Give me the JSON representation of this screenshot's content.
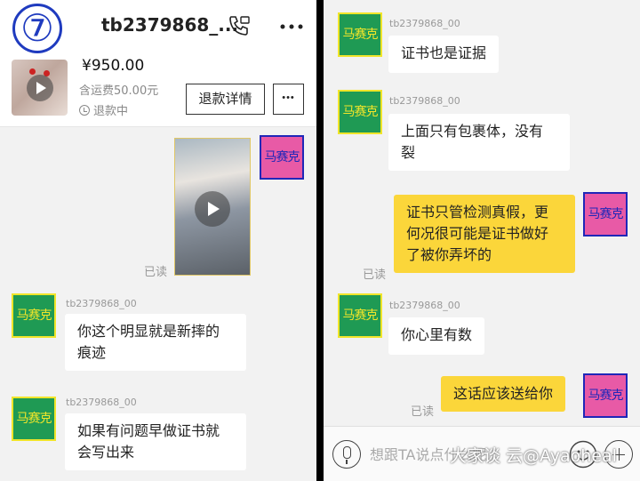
{
  "annotation": {
    "number": "⑦"
  },
  "left": {
    "header": {
      "title": "tb2379868_...",
      "order": {
        "price": "¥950.00",
        "shipping": "含运费50.00元",
        "status": "退款中"
      },
      "refund_button": "退款详情"
    },
    "messages": [
      {
        "type": "video",
        "sender": "seller",
        "avatar_text": "马赛克",
        "read": "已读"
      },
      {
        "type": "text",
        "sender": "buyer",
        "avatar_text": "马赛克",
        "username": "tb2379868_00",
        "lines": [
          "你这个明显就是新摔的",
          "痕迹"
        ]
      },
      {
        "type": "text",
        "sender": "buyer",
        "avatar_text": "马赛克",
        "username": "tb2379868_00",
        "lines": [
          "如果有问题早做证书就",
          "会写出来"
        ]
      }
    ]
  },
  "right": {
    "messages": [
      {
        "sender": "buyer",
        "avatar_text": "马赛克",
        "username": "tb2379868_00",
        "lines": [
          "证书也是证据"
        ]
      },
      {
        "sender": "buyer",
        "avatar_text": "马赛克",
        "username": "tb2379868_00",
        "lines": [
          "上面只有包裹体，没有",
          "裂"
        ]
      },
      {
        "sender": "seller",
        "avatar_text": "马赛克",
        "read": "已读",
        "lines": [
          "证书只管检测真假，更",
          "何况很可能是证书做好",
          "了被你弄坏的"
        ]
      },
      {
        "sender": "buyer",
        "avatar_text": "马赛克",
        "username": "tb2379868_00",
        "lines": [
          "你心里有数"
        ]
      },
      {
        "sender": "seller",
        "avatar_text": "马赛克",
        "read": "已读",
        "lines": [
          "这话应该送给你"
        ]
      }
    ],
    "input": {
      "placeholder": "想跟TA说点什么呢"
    },
    "watermark": "大家谈 云@Ayaoheal"
  },
  "colors": {
    "buyer_avatar": "#1f9a54",
    "seller_avatar": "#e85aa6",
    "seller_bubble": "#fbd63a",
    "annotation": "#1f3bbf"
  }
}
